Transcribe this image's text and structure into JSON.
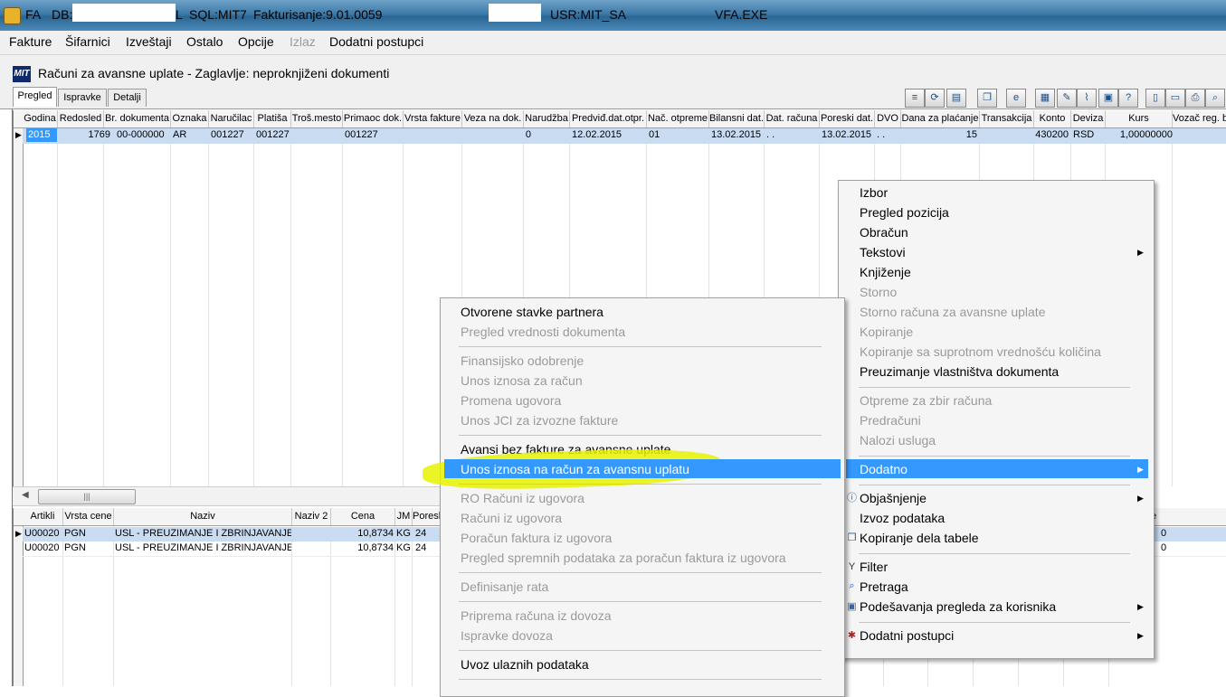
{
  "titlebar": {
    "app": "FA",
    "db_label": "DB:",
    "db_suffix": "L",
    "sql": "SQL:MIT7",
    "module": "Fakturisanje:9.01.0059",
    "user": "USR:MIT_SA",
    "exe": "VFA.EXE"
  },
  "menu": [
    "Fakture",
    "Šifarnici",
    "Izveštaji",
    "Ostalo",
    "Opcije",
    "Izlaz",
    "Dodatni postupci"
  ],
  "caption": {
    "logo": "MIT",
    "text": "Računi za avansne uplate - Zaglavlje: neproknjiženi dokumenti"
  },
  "tabs": [
    "Pregled",
    "Ispravke",
    "Detalji"
  ],
  "toolbar_icons": [
    "list-icon",
    "refresh-icon",
    "table-icon",
    "docs-icon",
    "internet-icon",
    "calendar-icon",
    "edit-icon",
    "attach-icon",
    "monitor-icon",
    "help-icon",
    "new-doc-icon",
    "folder-icon",
    "print-icon",
    "search-icon"
  ],
  "top_grid": {
    "headers": [
      "Godina",
      "Redosled",
      "Br. dokumenta",
      "Oznaka",
      "Naručilac",
      "Platiša",
      "Troš.mesto",
      "Primaoc dok.",
      "Vrsta fakture",
      "Veza na dok.",
      "Narudžba",
      "Predviđ.dat.otpr.",
      "Nač. otpreme",
      "Bilansni dat.",
      "Dat. računa",
      "Poreski dat.",
      "DVO",
      "Dana za plaćanje",
      "Transakcija",
      "Konto",
      "Deviza",
      "Kurs",
      "Vozač reg. b"
    ],
    "row": [
      "2015",
      "1769",
      "00-000000",
      "AR",
      "001227",
      "001227",
      "",
      "001227",
      "",
      "0",
      "",
      "12.02.2015",
      "01",
      "13.02.2015",
      ". .",
      "13.02.2015",
      ". .",
      "15",
      "",
      "430200",
      "RSD",
      "1,00000000",
      ""
    ]
  },
  "bottom_grid": {
    "headers": [
      "Artikli",
      "Vrsta cene",
      "Naziv",
      "Naziv 2",
      "Cena",
      "JM",
      "Poresl"
    ],
    "rows": [
      [
        "U00020",
        "PGN",
        "USL - PREUZIMANJE I ZBRINJAVANJE",
        "",
        "10,8734",
        "KG",
        "24"
      ],
      [
        "U00020",
        "PGN",
        "USL - PREUZIMANJE I ZBRINJAVANJE",
        "",
        "10,8734",
        "KG",
        "24"
      ]
    ],
    "right_fragments": [
      "e",
      "0",
      "0"
    ]
  },
  "context_menu": {
    "items": [
      {
        "label": "Izbor",
        "enabled": true
      },
      {
        "label": "Pregled pozicija",
        "enabled": true
      },
      {
        "label": "Obračun",
        "enabled": true
      },
      {
        "label": "Tekstovi",
        "enabled": true,
        "submenu": true
      },
      {
        "label": "Knjiženje",
        "enabled": true
      },
      {
        "label": "Storno",
        "enabled": false
      },
      {
        "label": "Storno računa za avansne uplate",
        "enabled": false
      },
      {
        "label": "Kopiranje",
        "enabled": false
      },
      {
        "label": "Kopiranje sa suprotnom vrednošću količina",
        "enabled": false
      },
      {
        "label": "Preuzimanje vlastništva dokumenta",
        "enabled": true
      },
      {
        "label": "Otpreme za zbir računa",
        "enabled": false
      },
      {
        "label": "Predračuni",
        "enabled": false
      },
      {
        "label": "Nalozi usluga",
        "enabled": false
      },
      {
        "label": "Dodatno",
        "enabled": true,
        "submenu": true,
        "selected": true
      },
      {
        "label": "Objašnjenje",
        "enabled": true,
        "submenu": true,
        "icon": "info-icon"
      },
      {
        "label": "Izvoz podataka",
        "enabled": true
      },
      {
        "label": "Kopiranje dela tabele",
        "enabled": true,
        "icon": "copy-icon"
      },
      {
        "label": "Filter",
        "enabled": true,
        "icon": "filter-icon"
      },
      {
        "label": "Pretraga",
        "enabled": true,
        "icon": "search-icon"
      },
      {
        "label": "Podešavanja pregleda za korisnika",
        "enabled": true,
        "submenu": true,
        "icon": "settings-icon"
      },
      {
        "label": "Dodatni postupci",
        "enabled": true,
        "submenu": true,
        "icon": "tools-icon"
      }
    ]
  },
  "submenu": {
    "items": [
      {
        "label": "Otvorene stavke partnera",
        "enabled": true
      },
      {
        "label": "Pregled vrednosti dokumenta",
        "enabled": false
      },
      {
        "label": "Finansijsko odobrenje",
        "enabled": false
      },
      {
        "label": "Unos iznosa za račun",
        "enabled": false
      },
      {
        "label": "Promena ugovora",
        "enabled": false
      },
      {
        "label": "Unos JCI za izvozne fakture",
        "enabled": false
      },
      {
        "label": "Avansi bez fakture za avansne uplate",
        "enabled": true
      },
      {
        "label": "Unos iznosa na račun za avansnu uplatu",
        "enabled": true,
        "selected": true
      },
      {
        "label": "RO Računi iz ugovora",
        "enabled": false
      },
      {
        "label": "Računi iz ugovora",
        "enabled": false
      },
      {
        "label": "Poračun faktura iz ugovora",
        "enabled": false
      },
      {
        "label": "Pregled spremnih podataka za poračun faktura iz ugovora",
        "enabled": false
      },
      {
        "label": "Definisanje rata",
        "enabled": false
      },
      {
        "label": "Priprema računa iz dovoza",
        "enabled": false
      },
      {
        "label": "Ispravke dovoza",
        "enabled": false
      },
      {
        "label": "Uvoz ulaznih podataka",
        "enabled": true
      }
    ]
  },
  "colors": {
    "selection": "#3399ff",
    "highlighter": "#e6f200",
    "disabled_text": "#9a9a9a"
  }
}
